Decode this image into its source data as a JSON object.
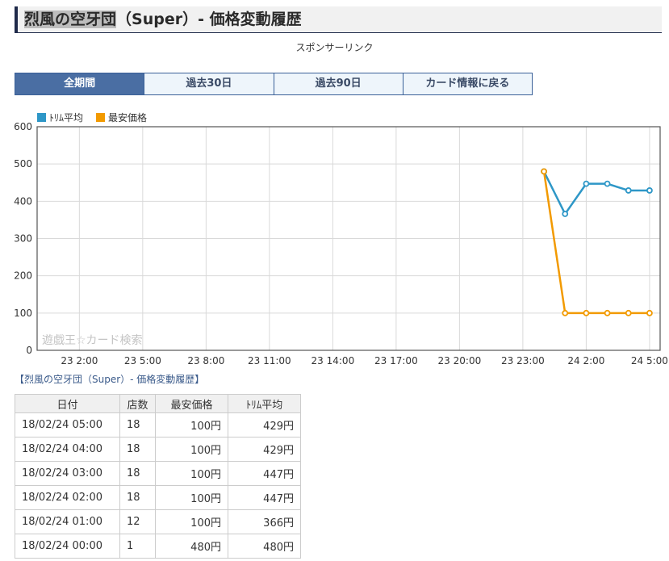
{
  "header": {
    "title_highlight": "烈風の空牙団",
    "title_rest": "（Super）- 価格変動履歴"
  },
  "sponsor_label": "スポンサーリンク",
  "tabs": [
    {
      "label": "全期間",
      "active": true
    },
    {
      "label": "過去30日",
      "active": false
    },
    {
      "label": "過去90日",
      "active": false
    },
    {
      "label": "カード情報に戻る",
      "active": false
    }
  ],
  "legend": [
    {
      "label": "ﾄﾘﾑ平均",
      "color": "#2e97c7"
    },
    {
      "label": "最安価格",
      "color": "#f29a00"
    }
  ],
  "chart_data": {
    "type": "line",
    "watermark": "遊戯王☆カード検索",
    "ylim": [
      0,
      600
    ],
    "y_ticks": [
      0,
      100,
      200,
      300,
      400,
      500,
      600
    ],
    "x_range_hours": [
      0,
      29.5
    ],
    "x_ticks": [
      {
        "label": "23 2:00",
        "h": 2
      },
      {
        "label": "23 5:00",
        "h": 5
      },
      {
        "label": "23 8:00",
        "h": 8
      },
      {
        "label": "23 11:00",
        "h": 11
      },
      {
        "label": "23 14:00",
        "h": 14
      },
      {
        "label": "23 17:00",
        "h": 17
      },
      {
        "label": "23 20:00",
        "h": 20
      },
      {
        "label": "23 23:00",
        "h": 23
      },
      {
        "label": "24 2:00",
        "h": 26
      },
      {
        "label": "24 5:00",
        "h": 29
      }
    ],
    "series": [
      {
        "name": "ﾄﾘﾑ平均",
        "color": "#2e97c7",
        "points": [
          [
            24,
            480
          ],
          [
            25,
            366
          ],
          [
            26,
            447
          ],
          [
            27,
            447
          ],
          [
            28,
            429
          ],
          [
            29,
            429
          ]
        ]
      },
      {
        "name": "最安価格",
        "color": "#f29a00",
        "points": [
          [
            24,
            480
          ],
          [
            25,
            100
          ],
          [
            26,
            100
          ],
          [
            27,
            100
          ],
          [
            28,
            100
          ],
          [
            29,
            100
          ]
        ]
      }
    ]
  },
  "caption": "【烈風の空牙団（Super）- 価格変動履歴】",
  "table": {
    "headers": [
      "日付",
      "店数",
      "最安価格",
      "ﾄﾘﾑ平均"
    ],
    "rows": [
      [
        "18/02/24 05:00",
        "18",
        "100円",
        "429円"
      ],
      [
        "18/02/24 04:00",
        "18",
        "100円",
        "429円"
      ],
      [
        "18/02/24 03:00",
        "18",
        "100円",
        "447円"
      ],
      [
        "18/02/24 02:00",
        "18",
        "100円",
        "447円"
      ],
      [
        "18/02/24 01:00",
        "12",
        "100円",
        "366円"
      ],
      [
        "18/02/24 00:00",
        "1",
        "480円",
        "480円"
      ]
    ]
  }
}
